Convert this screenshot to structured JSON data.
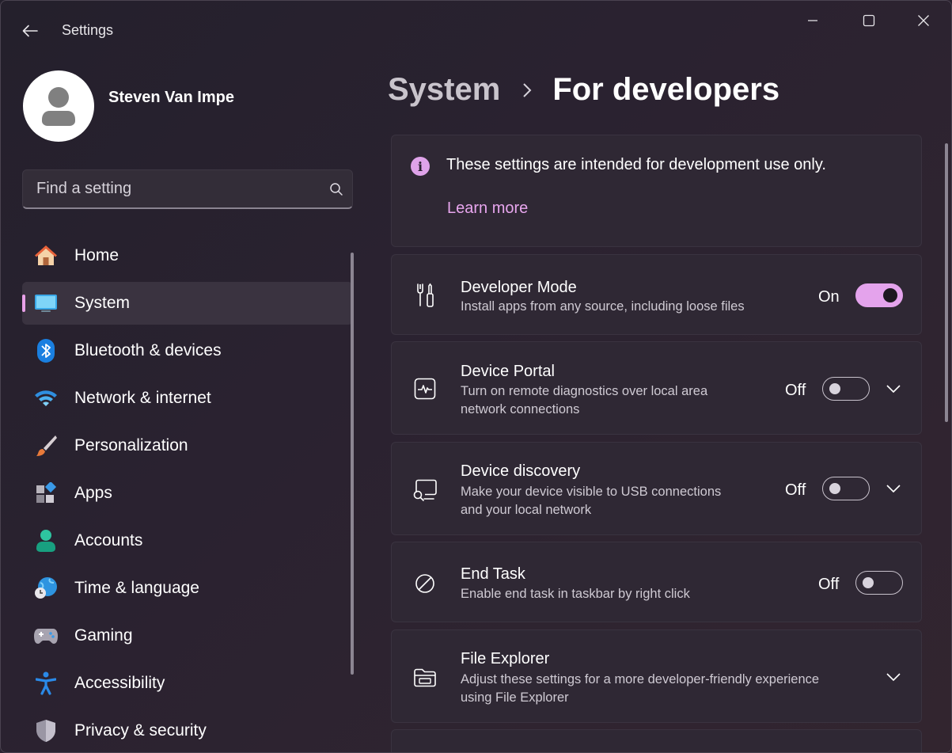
{
  "window": {
    "title": "Settings",
    "back_icon": "back-arrow-icon",
    "controls": [
      "minimize-icon",
      "maximize-icon",
      "close-icon"
    ]
  },
  "profile": {
    "name": "Steven Van Impe"
  },
  "search": {
    "placeholder": "Find a setting"
  },
  "sidebar": {
    "items": [
      {
        "label": "Home",
        "icon": "home-icon"
      },
      {
        "label": "System",
        "icon": "monitor-icon",
        "active": true
      },
      {
        "label": "Bluetooth & devices",
        "icon": "bluetooth-icon"
      },
      {
        "label": "Network & internet",
        "icon": "wifi-icon"
      },
      {
        "label": "Personalization",
        "icon": "paintbrush-icon"
      },
      {
        "label": "Apps",
        "icon": "apps-icon"
      },
      {
        "label": "Accounts",
        "icon": "account-icon"
      },
      {
        "label": "Time & language",
        "icon": "globe-clock-icon"
      },
      {
        "label": "Gaming",
        "icon": "gamepad-icon"
      },
      {
        "label": "Accessibility",
        "icon": "accessibility-icon"
      },
      {
        "label": "Privacy & security",
        "icon": "shield-icon"
      }
    ]
  },
  "breadcrumb": {
    "parent": "System",
    "current": "For developers"
  },
  "info": {
    "text": "These settings are intended for development use only.",
    "link": "Learn more"
  },
  "settings": [
    {
      "title": "Developer Mode",
      "desc": "Install apps from any source, including loose files",
      "state": "On",
      "icon": "developer-tools-icon"
    },
    {
      "title": "Device Portal",
      "desc1": "Turn on remote diagnostics over local area",
      "desc2": "network connections",
      "state": "Off",
      "icon": "device-portal-icon"
    },
    {
      "title": "Device discovery",
      "desc1": "Make your device visible to USB connections",
      "desc2": "and your local network",
      "state": "Off",
      "icon": "device-discovery-icon"
    },
    {
      "title": "End Task",
      "desc": "Enable end task in taskbar by right click",
      "state": "Off",
      "icon": "end-task-icon"
    },
    {
      "title": "File Explorer",
      "desc1": "Adjust these settings for a more developer-friendly experience",
      "desc2": "using File Explorer",
      "icon": "folder-icon"
    }
  ],
  "colors": {
    "accent": "#e4a3ec",
    "card": "#2f2834",
    "background": "#2a2230"
  }
}
